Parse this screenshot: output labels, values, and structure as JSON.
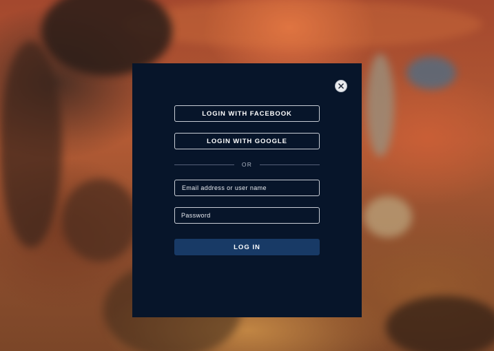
{
  "background": {
    "description": "blurred recording studio"
  },
  "modal": {
    "close_icon": "close-icon",
    "facebook_label": "LOGIN WITH FACEBOOK",
    "google_label": "LOGIN WITH GOOGLE",
    "divider_text": "OR",
    "email_placeholder": "Email address or user name",
    "password_placeholder": "Password",
    "login_label": "LOG IN"
  },
  "colors": {
    "modal_bg": "#07152a",
    "login_button": "#183a66",
    "border": "#c9ced6"
  }
}
